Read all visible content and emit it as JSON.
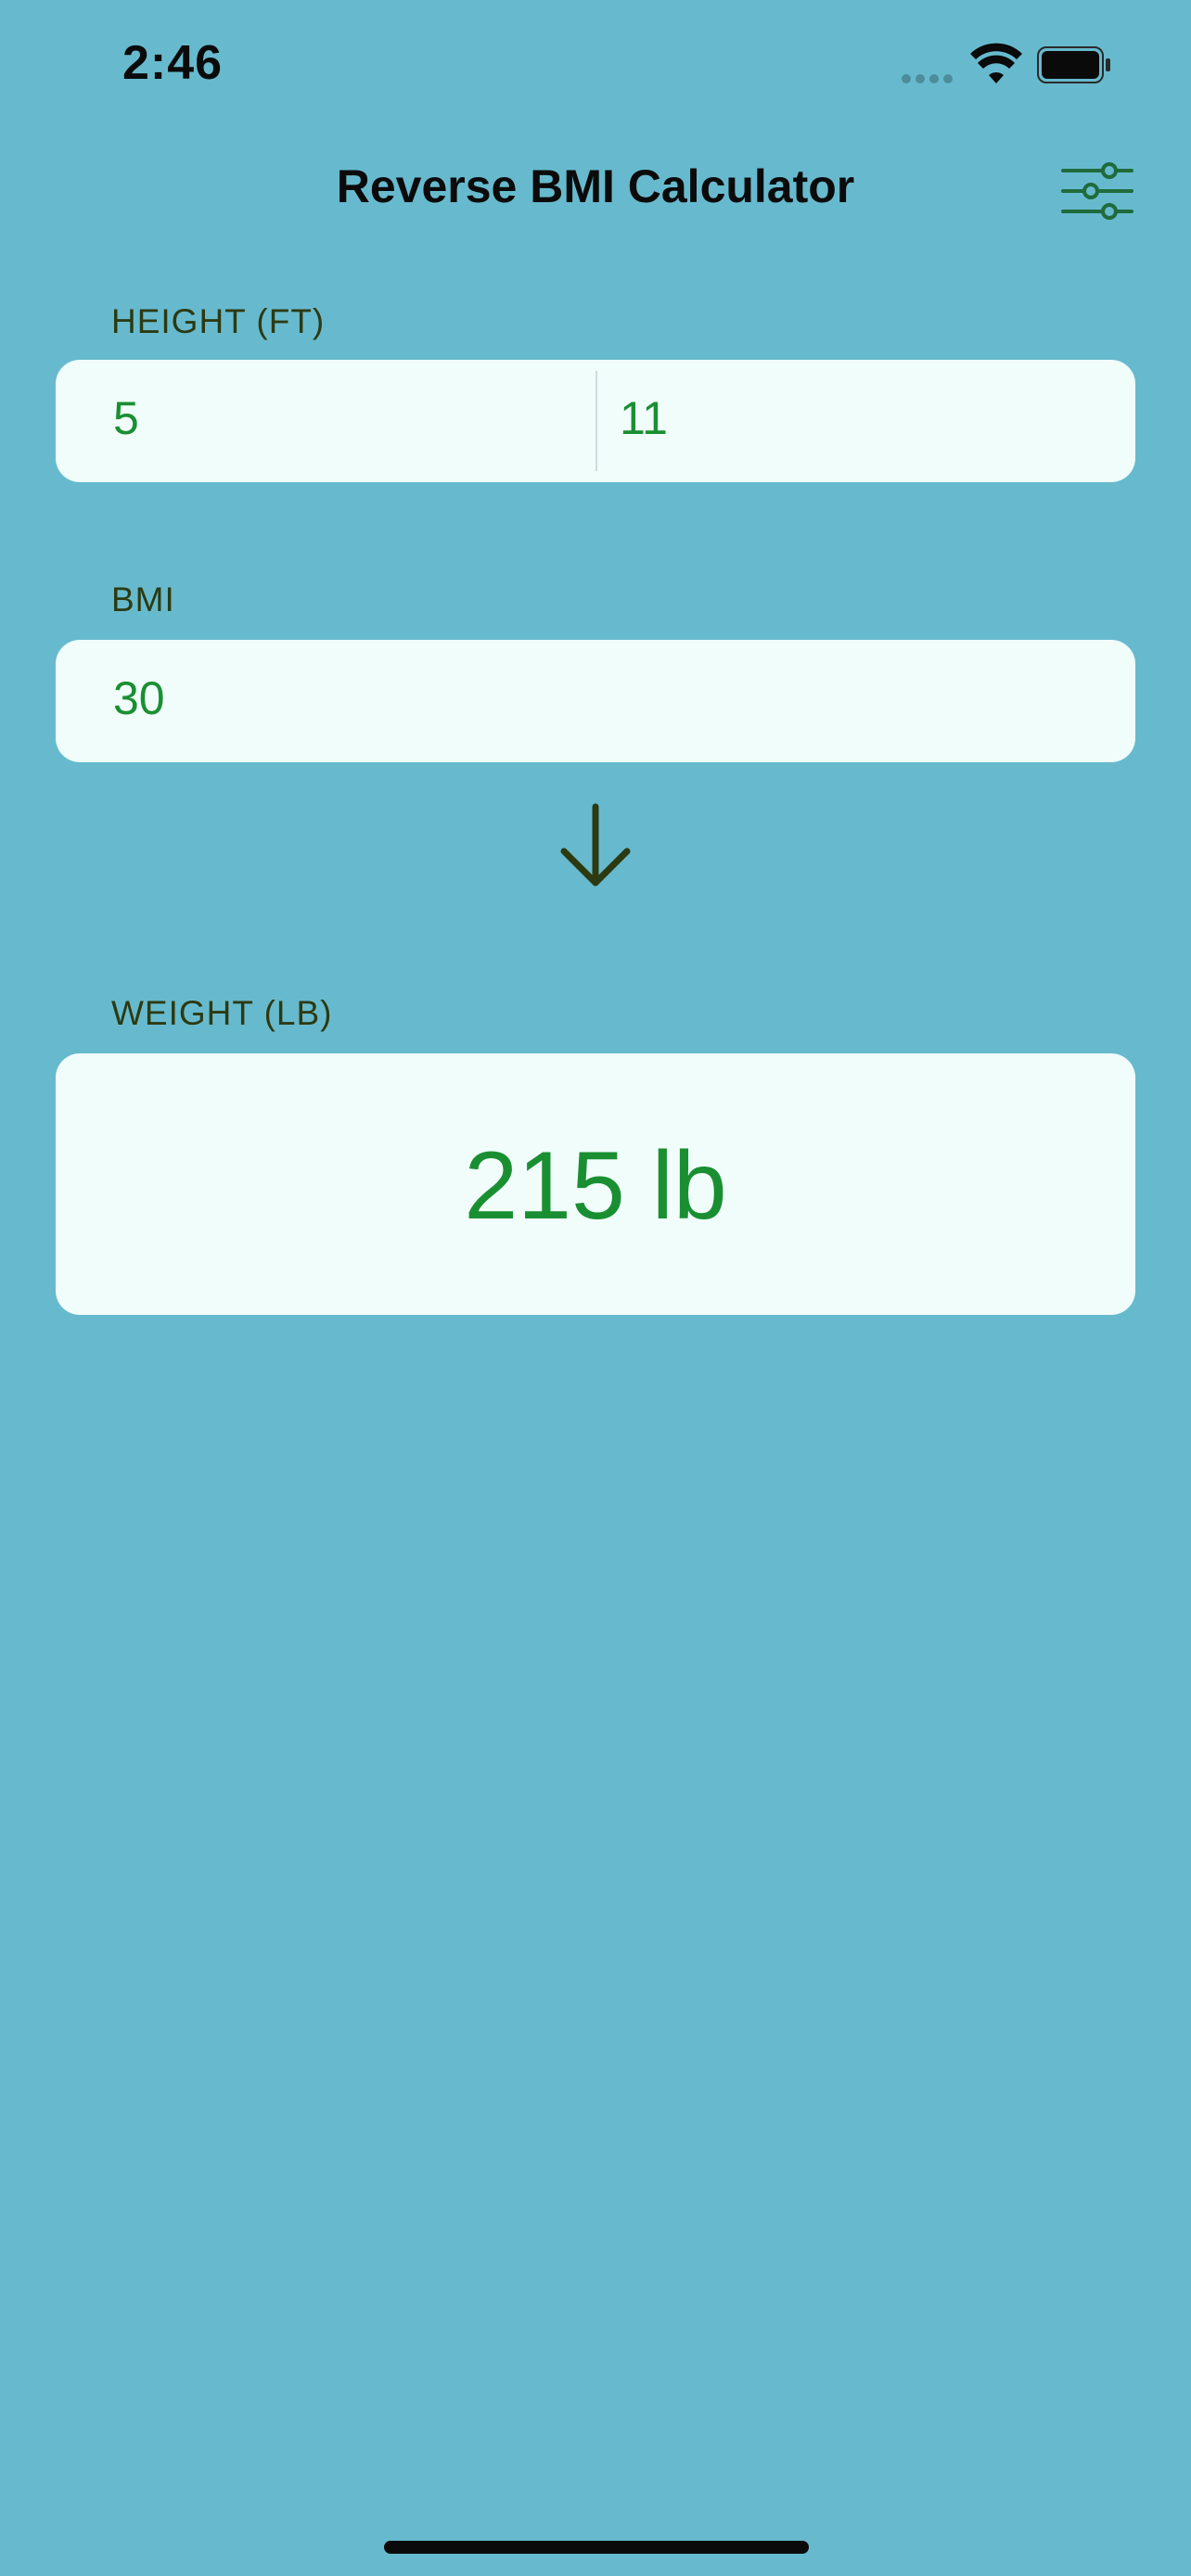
{
  "status_bar": {
    "time": "2:46"
  },
  "nav": {
    "title": "Reverse BMI Calculator",
    "settings_icon": "sliders-icon"
  },
  "height": {
    "label": "HEIGHT (FT)",
    "feet": "5",
    "inches": "11"
  },
  "bmi": {
    "label": "BMI",
    "value": "30"
  },
  "arrow_icon": "arrow-down-icon",
  "weight": {
    "label": "WEIGHT (LB)",
    "result": "215 lb"
  },
  "colors": {
    "background": "#67bace",
    "card": "#f0fdfb",
    "value_green": "#1a8f32",
    "label_dark": "#2c3a12",
    "accent_icon": "#1f6b3c"
  }
}
